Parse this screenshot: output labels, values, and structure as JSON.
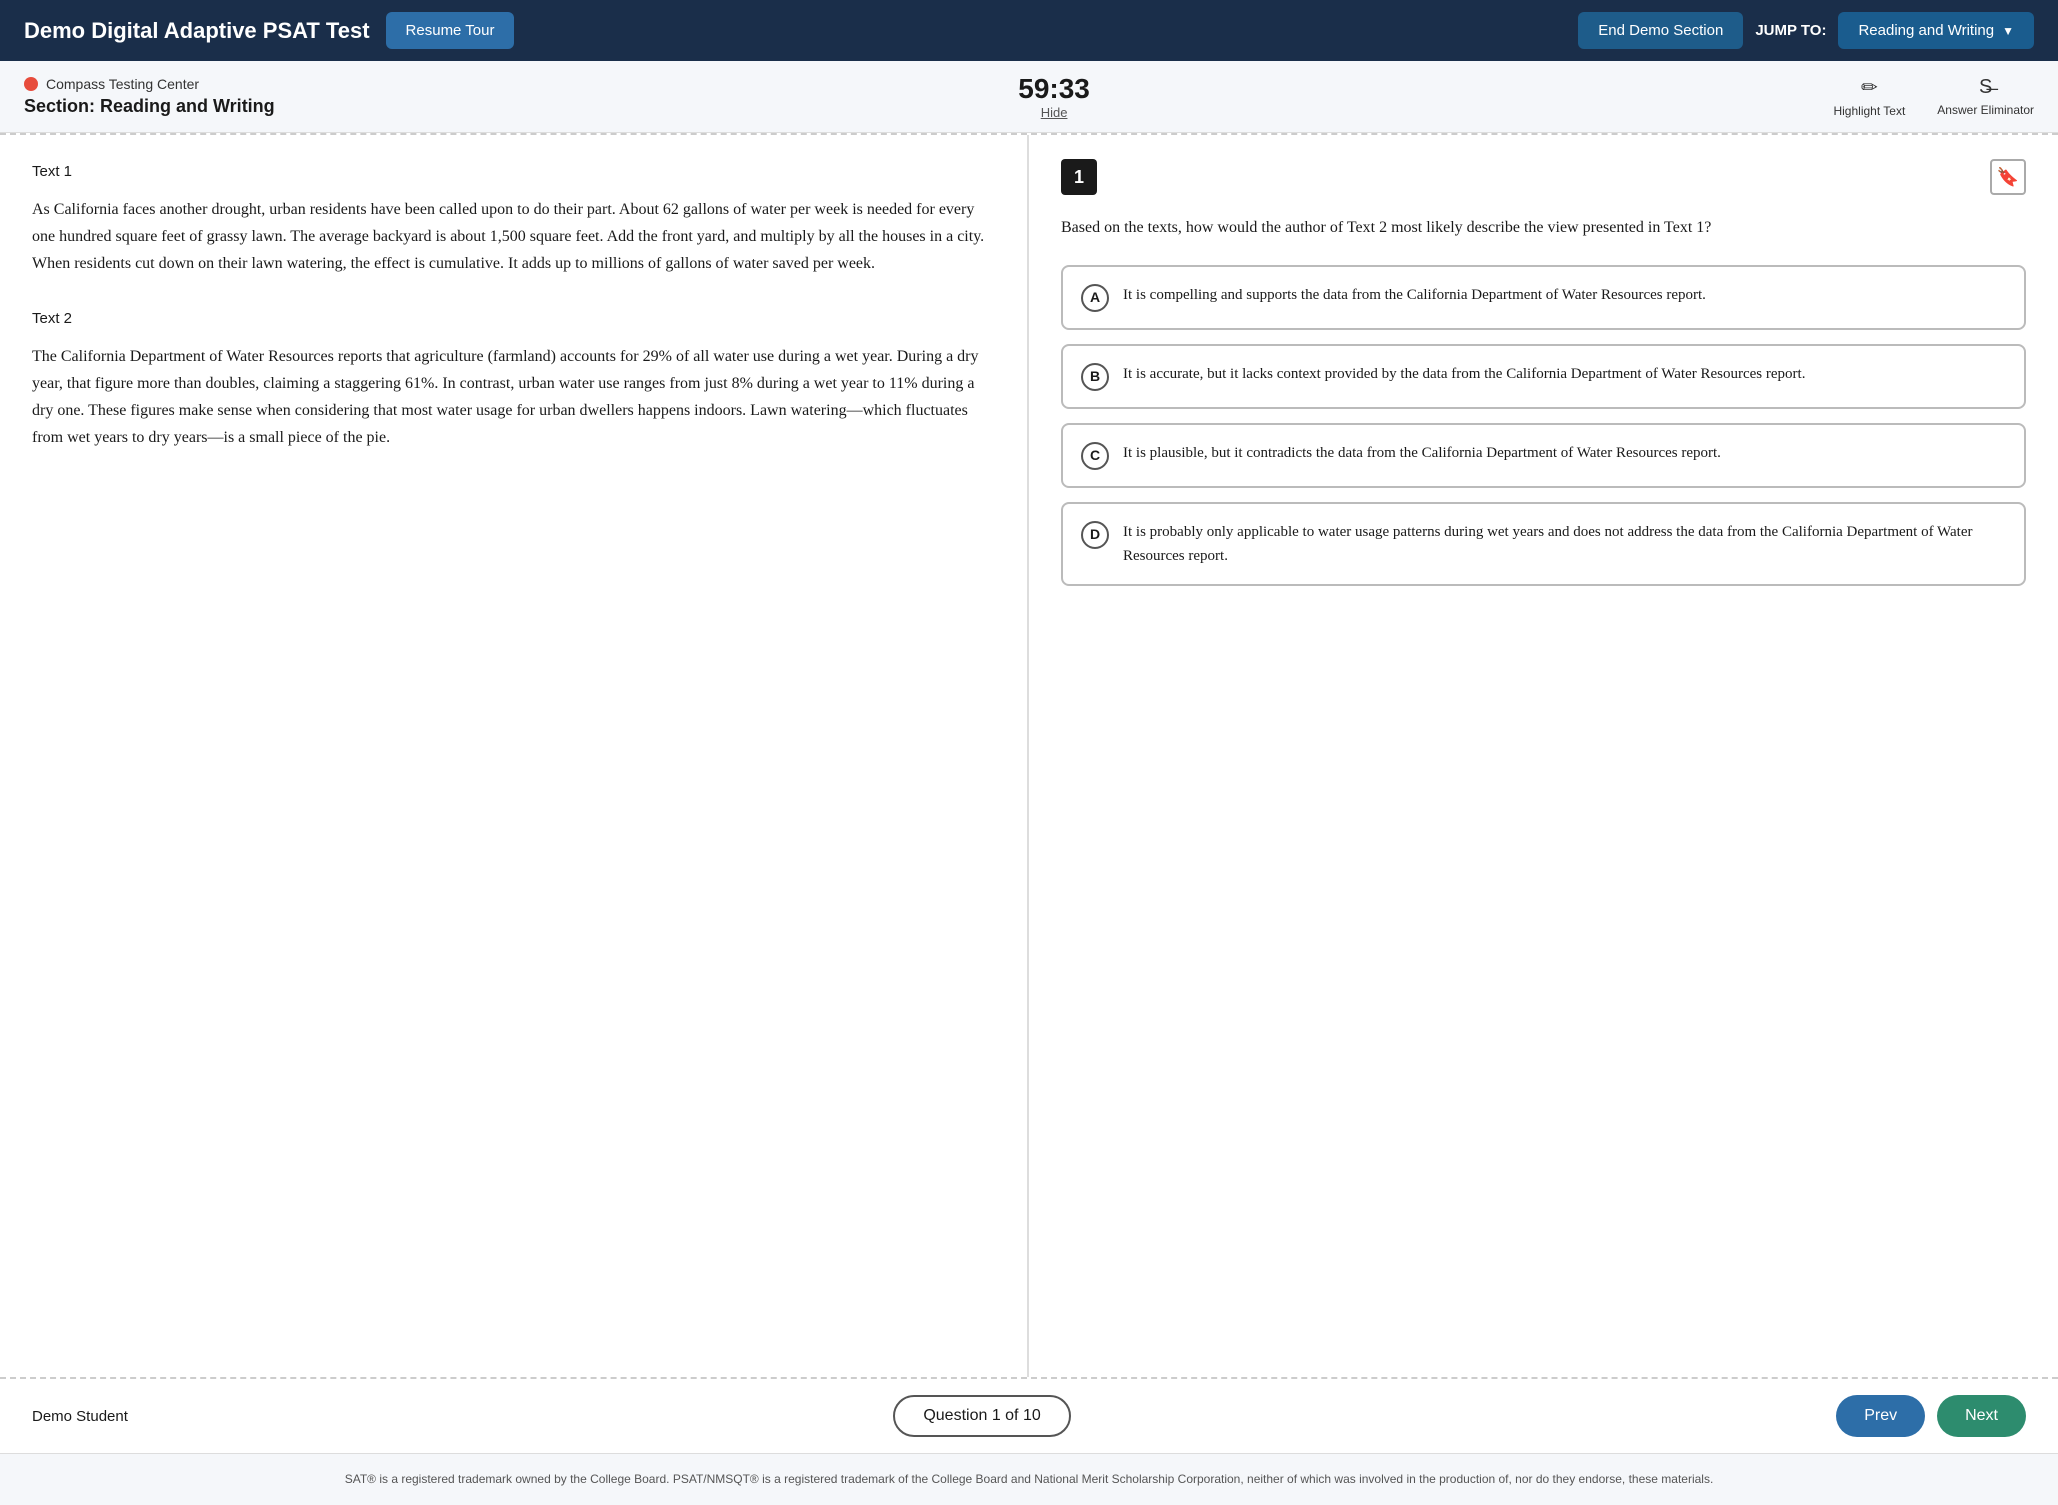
{
  "topNav": {
    "title": "Demo Digital Adaptive PSAT Test",
    "resumeTourLabel": "Resume Tour",
    "endDemoLabel": "End Demo Section",
    "jumpToLabel": "JUMP TO:",
    "jumpToOption": "Reading and Writing"
  },
  "sectionHeader": {
    "orgName": "Compass Testing Center",
    "sectionLabel": "Section: Reading and Writing",
    "timer": "59:33",
    "hideLabel": "Hide",
    "highlightTextLabel": "Highlight Text",
    "answerEliminatorLabel": "Answer Eliminator"
  },
  "passage": {
    "text1Label": "Text 1",
    "text1": "As California faces another drought, urban residents have been called upon to do their part. About 62 gallons of water per week is needed for every one hundred square feet of grassy lawn. The average backyard is about 1,500 square feet. Add the front yard, and multiply by all the houses in a city. When residents cut down on their lawn watering, the effect is cumulative. It adds up to millions of gallons of water saved per week.",
    "text2Label": "Text 2",
    "text2": "The California Department of Water Resources reports that agriculture (farmland) accounts for 29% of all water use during a wet year. During a dry year, that figure more than doubles, claiming a staggering 61%. In contrast, urban water use ranges from just 8% during a wet year to 11% during a dry one. These figures make sense when considering that most water usage for urban dwellers happens indoors. Lawn watering—which fluctuates from wet years to dry years—is a small piece of the pie."
  },
  "question": {
    "number": "1",
    "text": "Based on the texts, how would the author of Text 2 most likely describe the view presented in Text 1?",
    "choices": [
      {
        "letter": "A",
        "text": "It is compelling and supports the data from the California Department of Water Resources report."
      },
      {
        "letter": "B",
        "text": "It is accurate, but it lacks context provided by the data from the California Department of Water Resources report."
      },
      {
        "letter": "C",
        "text": "It is plausible, but it contradicts the data from the California Department of Water Resources report."
      },
      {
        "letter": "D",
        "text": "It is probably only applicable to water usage patterns during wet years and does not address the data from the California Department of Water Resources report."
      }
    ]
  },
  "footer": {
    "studentName": "Demo Student",
    "questionOf": "Question 1 of 10",
    "prevLabel": "Prev",
    "nextLabel": "Next"
  },
  "legal": {
    "text": "SAT® is a registered trademark owned by the College Board. PSAT/NMSQT® is a registered trademark of the College Board and National Merit Scholarship Corporation, neither of which was involved in the production of, nor do they endorse, these materials."
  }
}
